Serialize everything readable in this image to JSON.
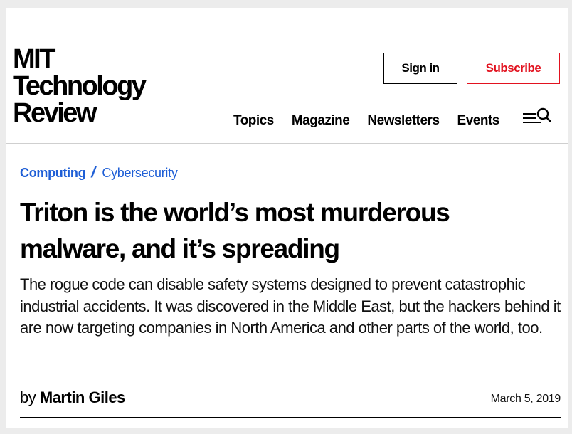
{
  "header": {
    "logo_lines": [
      "MIT",
      "Technology",
      "Review"
    ],
    "sign_in_label": "Sign in",
    "subscribe_label": "Subscribe",
    "nav": [
      "Topics",
      "Magazine",
      "Newsletters",
      "Events"
    ],
    "menu_icon": "hamburger-menu-icon",
    "search_icon": "search-icon"
  },
  "article": {
    "breadcrumb": {
      "primary": "Computing",
      "separator": "/",
      "secondary": "Cybersecurity"
    },
    "headline": "Triton is the world’s most murderous malware, and it’s spreading",
    "dek": "The rogue code can disable safety systems designed to prevent catastrophic industrial accidents. It was discovered in the Middle East, but the hackers behind it are now targeting companies in North America and other parts of the world, too.",
    "byline_prefix": "by",
    "author": "Martin Giles",
    "date": "March 5, 2019"
  },
  "colors": {
    "accent_blue": "#1f5fd6",
    "subscribe_red": "#e2121f",
    "text": "#000000"
  }
}
